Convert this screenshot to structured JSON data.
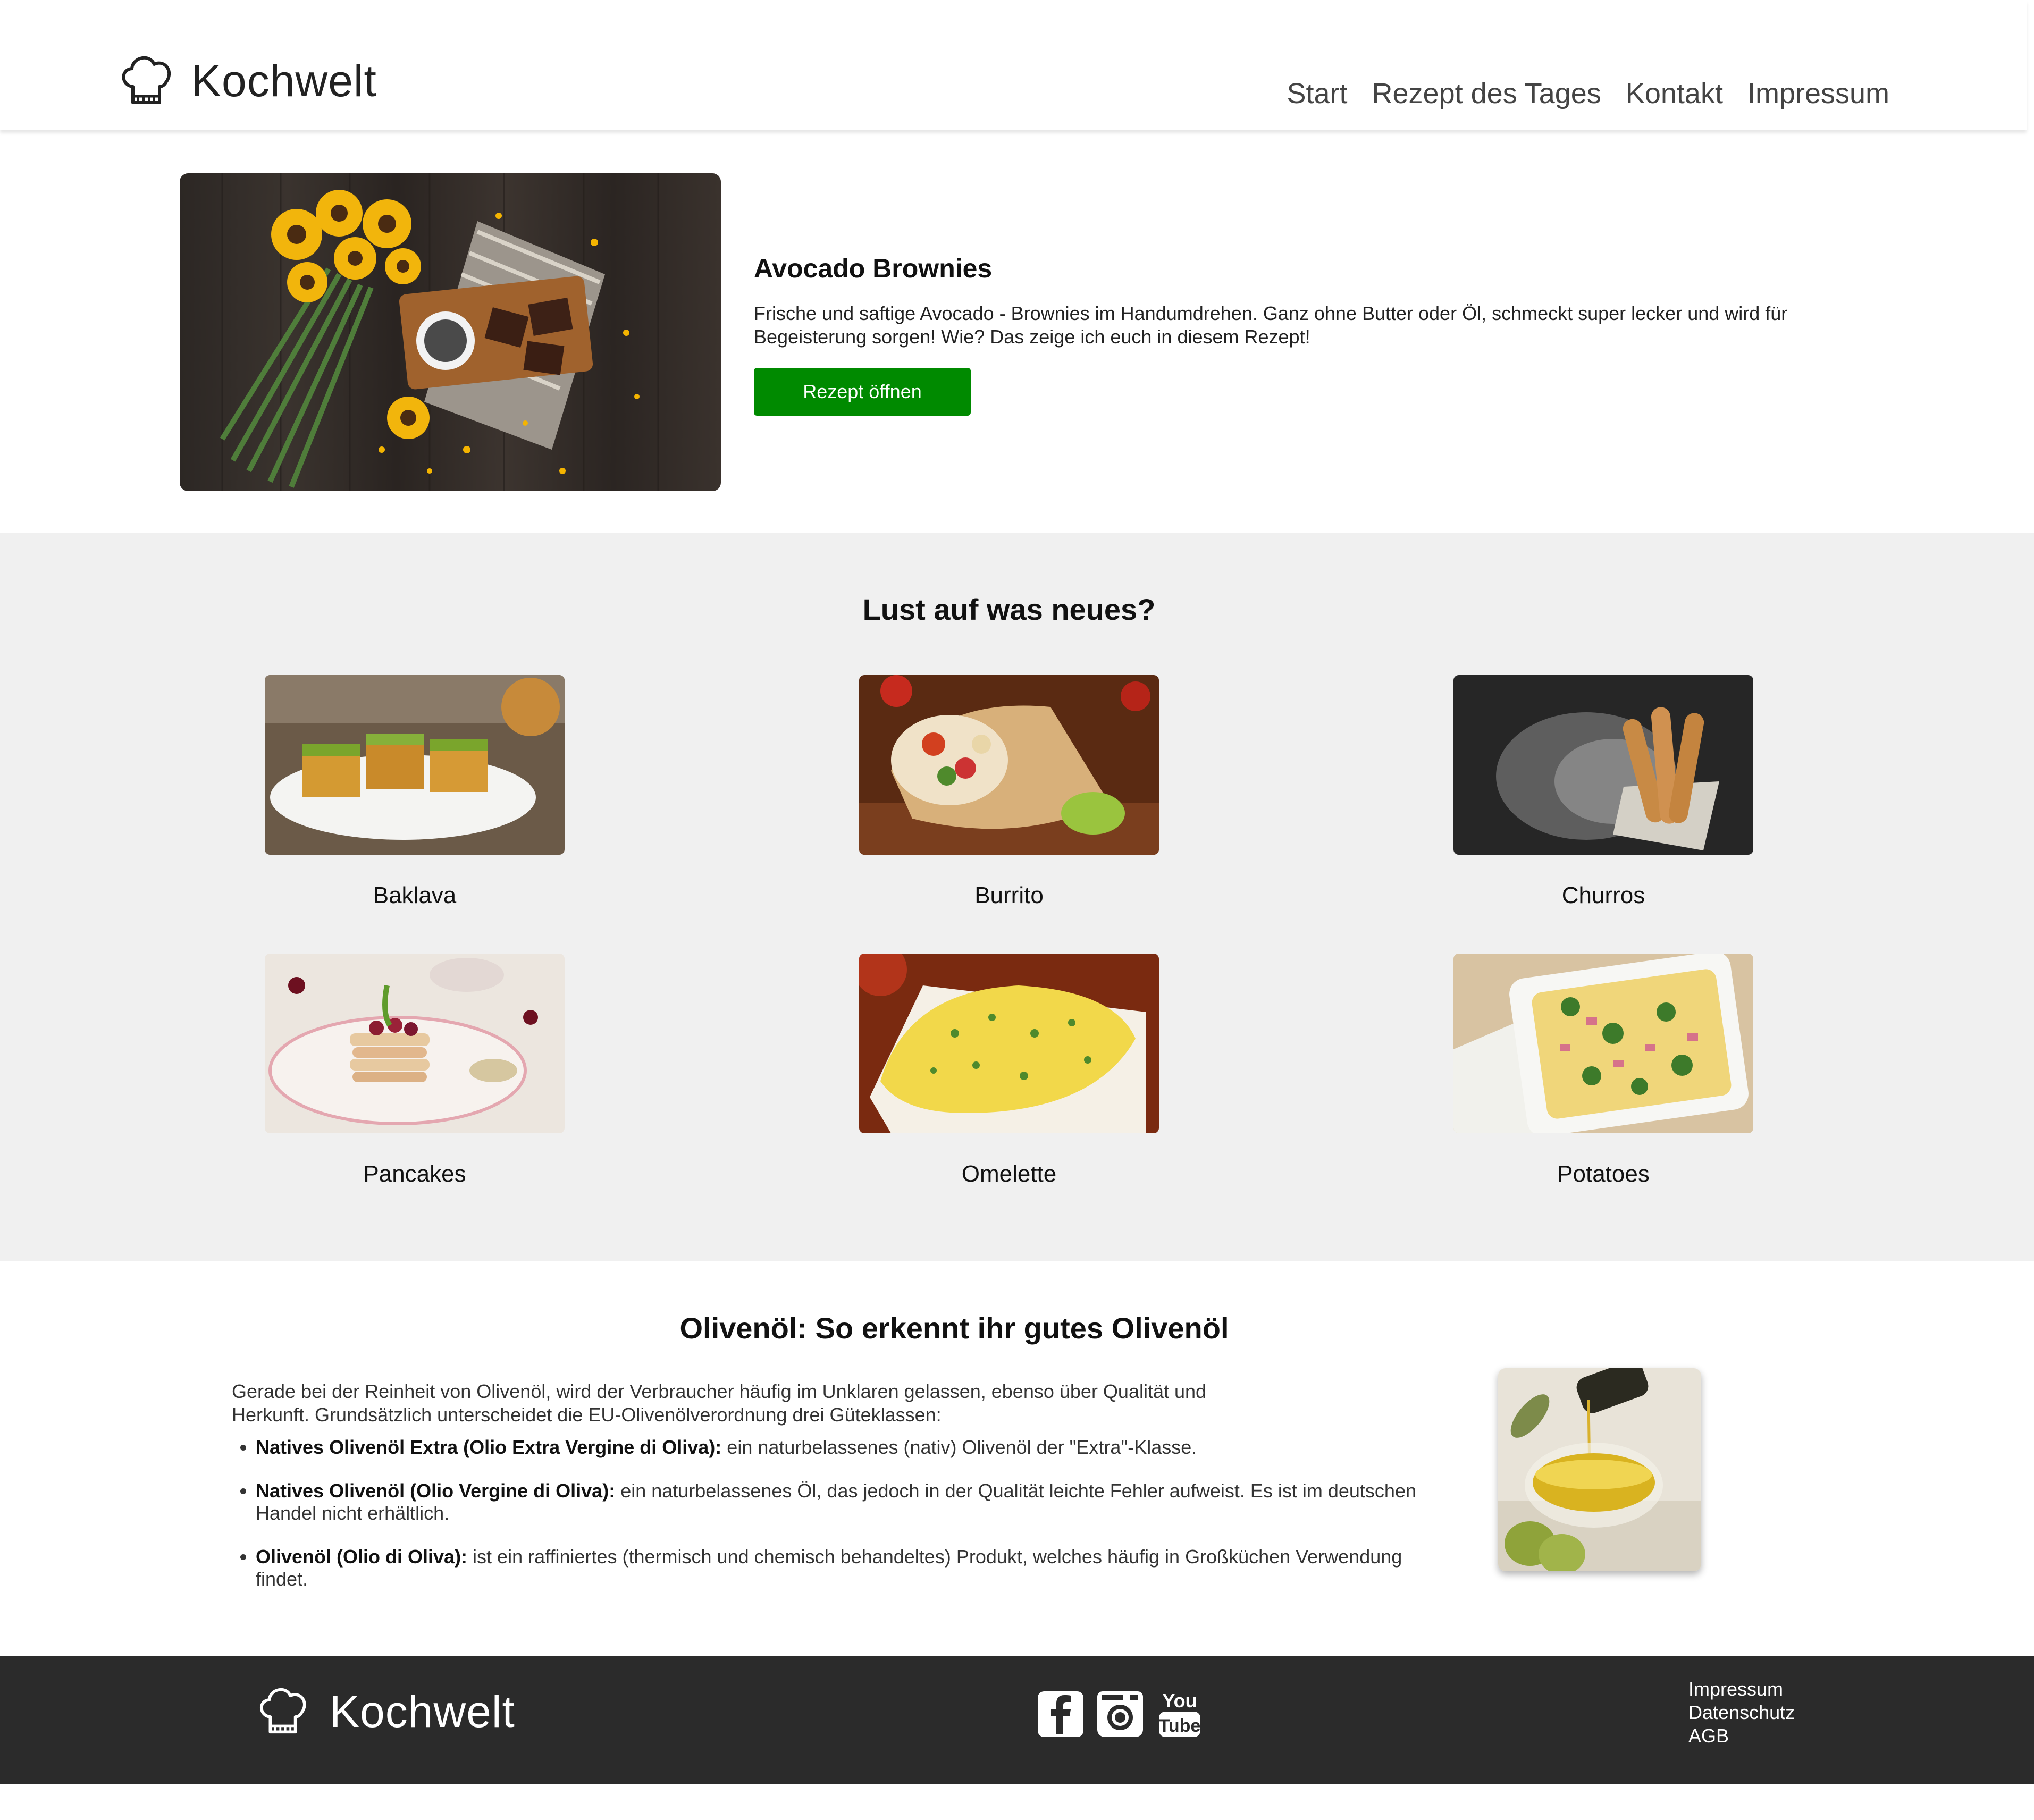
{
  "brand": {
    "name": "Kochwelt",
    "logo_icon": "chef-hat-icon"
  },
  "nav": {
    "items": [
      {
        "label": "Start"
      },
      {
        "label": "Rezept des Tages"
      },
      {
        "label": "Kontakt"
      },
      {
        "label": "Impressum"
      }
    ]
  },
  "hero": {
    "title": "Avocado Brownies",
    "description": "Frische und saftige Avocado - Brownies im Handumdrehen. Ganz ohne Butter oder Öl, schmeckt super lecker und wird für Begeisterung sorgen! Wie? Das zeige ich euch in diesem Rezept!",
    "button_label": "Rezept öffnen",
    "button_color": "#008a00"
  },
  "gallery": {
    "title": "Lust auf was neues?",
    "background": "#f0f0f0",
    "items": [
      {
        "label": "Baklava"
      },
      {
        "label": "Burrito"
      },
      {
        "label": "Churros"
      },
      {
        "label": "Pancakes"
      },
      {
        "label": "Omelette"
      },
      {
        "label": "Potatoes"
      }
    ]
  },
  "article": {
    "title": "Olivenöl: So erkennt ihr gutes Olivenöl",
    "intro": "Gerade bei der Reinheit von Olivenöl, wird der Verbraucher häufig im Unklaren gelassen, ebenso über Qualität und Herkunft. Grundsätzlich unterscheidet die EU-Olivenölverordnung drei Güteklassen:",
    "items": [
      {
        "term": "Natives Olivenöl Extra (Olio Extra Vergine di Oliva):",
        "text": " ein naturbelassenes (nativ) Olivenöl der \"Extra\"-Klasse."
      },
      {
        "term": "Natives Olivenöl (Olio Vergine di Oliva):",
        "text": " ein naturbelassenes Öl, das jedoch in der Qualität leichte Fehler aufweist. Es ist im deutschen Handel nicht erhältlich."
      },
      {
        "term": "Olivenöl (Olio di Oliva):",
        "text": " ist ein raffiniertes (thermisch und chemisch behandeltes) Produkt, welches häufig in Großküchen Verwendung findet."
      }
    ]
  },
  "footer": {
    "brand": "Kochwelt",
    "background": "#2b2b2b",
    "socials": [
      {
        "icon": "facebook-icon"
      },
      {
        "icon": "instagram-icon"
      },
      {
        "icon": "youtube-icon",
        "text_top": "You",
        "text_bottom": "Tube"
      }
    ],
    "links": [
      {
        "label": "Impressum"
      },
      {
        "label": "Datenschutz"
      },
      {
        "label": "AGB"
      }
    ]
  }
}
